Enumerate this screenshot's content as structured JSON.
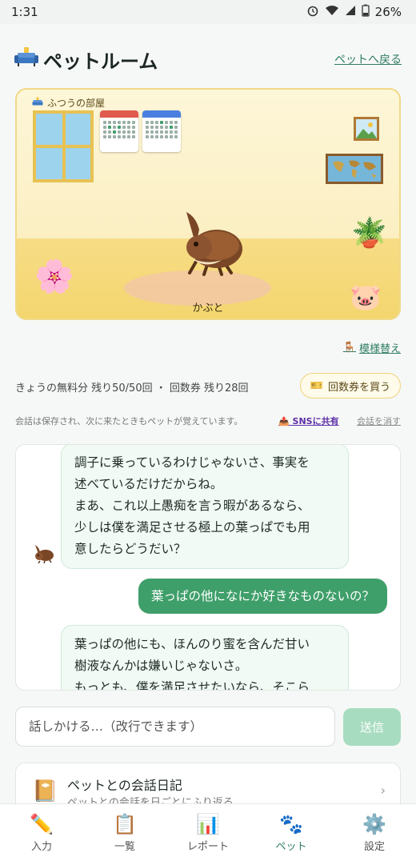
{
  "statusbar": {
    "time": "1:31",
    "battery": "26%"
  },
  "header": {
    "title": "ペットルーム",
    "back_link": "ペットへ戻る"
  },
  "room": {
    "label": "ふつうの部屋",
    "pet_name": "かぶと",
    "pattern_link": "模様替え"
  },
  "quota": {
    "text": "きょうの無料分 残り50/50回 ・ 回数券 残り28回",
    "buy_button": "回数券を買う"
  },
  "info": {
    "text": "会話は保存され、次に来たときもペットが覚えています。",
    "share": "SNSに共有",
    "clear": "会話を消す"
  },
  "chat": {
    "messages": [
      {
        "role": "pet",
        "lines": [
          "調子に乗っているわけじゃないさ、事実を",
          "述べているだけだからね。",
          "まあ、これ以上愚痴を言う暇があるなら、",
          "少しは僕を満足させる極上の葉っぱでも用",
          "意したらどうだい？"
        ]
      },
      {
        "role": "user",
        "text": "葉っぱの他になにか好きなものないの？"
      },
      {
        "role": "pet",
        "lines": [
          "葉っぱの他にも、ほんのり蜜を含んだ甘い",
          "樹液なんかは嫌いじゃないさ。",
          "もっとも、僕を満足させたいなら、そこら"
        ]
      }
    ]
  },
  "composer": {
    "placeholder": "話しかける…（改行できます）",
    "send": "送信"
  },
  "diary": {
    "title": "ペットとの会話日記",
    "subtitle": "ペットとの会話を日ごとにふり返る"
  },
  "nav": [
    {
      "label": "入力",
      "icon": "pencil-icon",
      "glyph": "✏️"
    },
    {
      "label": "一覧",
      "icon": "clipboard-icon",
      "glyph": "📋"
    },
    {
      "label": "レポート",
      "icon": "chart-icon",
      "glyph": "📊"
    },
    {
      "label": "ペット",
      "icon": "paw-icon",
      "glyph": "🐾",
      "active": true
    },
    {
      "label": "設定",
      "icon": "gear-icon",
      "glyph": "⚙️"
    }
  ],
  "colors": {
    "accent": "#2f7d62",
    "user_bubble": "#3f9f6a",
    "send_disabled": "#a8dcc0"
  }
}
